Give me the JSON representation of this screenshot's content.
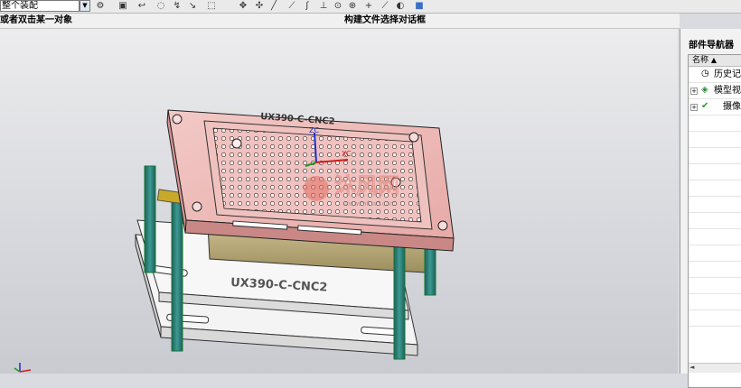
{
  "toolbar": {
    "filter_value": "整个装配",
    "icons": [
      "assembly-icon",
      "camera-icon",
      "undo-icon",
      "spin-icon",
      "sheet-icon",
      "select-icon",
      "snap-icon",
      "pt-icon",
      "line-icon",
      "endpoint-icon",
      "curve-icon",
      "angle-icon",
      "arc-icon",
      "cross-icon",
      "tangent-icon",
      "view-icon",
      "cube-icon"
    ]
  },
  "status": {
    "prompt": "或者双击某一对象",
    "mid": "构建文件选择对话框"
  },
  "model": {
    "plate_label": "UX390-C-CNC2",
    "base_label": "UX390-C-CNC2",
    "watermark": "沐风网",
    "watermark_sub": "www.mfcad.com",
    "axis_z": "ZC",
    "axis_x": "XC"
  },
  "navigator": {
    "title": "部件导航器",
    "col_name": "名称",
    "rows": [
      {
        "label": "历史记录",
        "icon": "clock-icon"
      },
      {
        "label": "模型视图",
        "icon": "views-icon"
      },
      {
        "label": "摄像机",
        "icon": "camera-icon"
      }
    ]
  },
  "colors": {
    "plate": "#e8b0ae",
    "pillar": "#2f7f7a",
    "base": "#f5f5f5",
    "core": "#b8a777"
  }
}
